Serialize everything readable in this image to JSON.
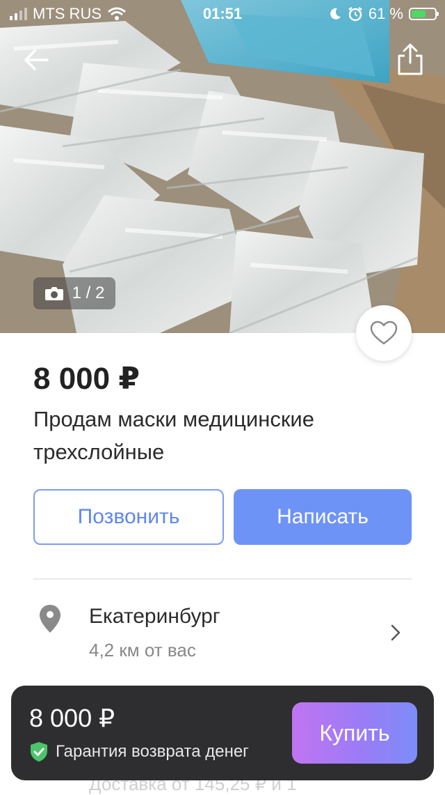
{
  "status_bar": {
    "carrier": "MTS RUS",
    "time": "01:51",
    "battery": "61 %",
    "battery_level": 0.61
  },
  "gallery": {
    "counter": "1 / 2",
    "icons": {
      "back": "arrow-left-icon",
      "share": "share-icon",
      "camera": "camera-icon",
      "favorite": "heart-icon"
    }
  },
  "listing": {
    "price": "8 000 ₽",
    "title": "Продам маски медицинские трехслойные"
  },
  "actions": {
    "call_label": "Позвонить",
    "message_label": "Написать"
  },
  "location": {
    "city": "Екатеринбург",
    "distance": "4,2 км от вас"
  },
  "delivery_peek": "Доставка от 145,25 ₽ и 1",
  "buy_bar": {
    "price": "8 000 ₽",
    "guarantee": "Гарантия возврата денег",
    "buy_label": "Купить"
  },
  "colors": {
    "accent": "#6e93f7",
    "buy_gradient_start": "#c174f2",
    "buy_gradient_end": "#7d8cf8",
    "bar_background": "#2e2e30",
    "guarantee_green": "#4cc46a"
  }
}
